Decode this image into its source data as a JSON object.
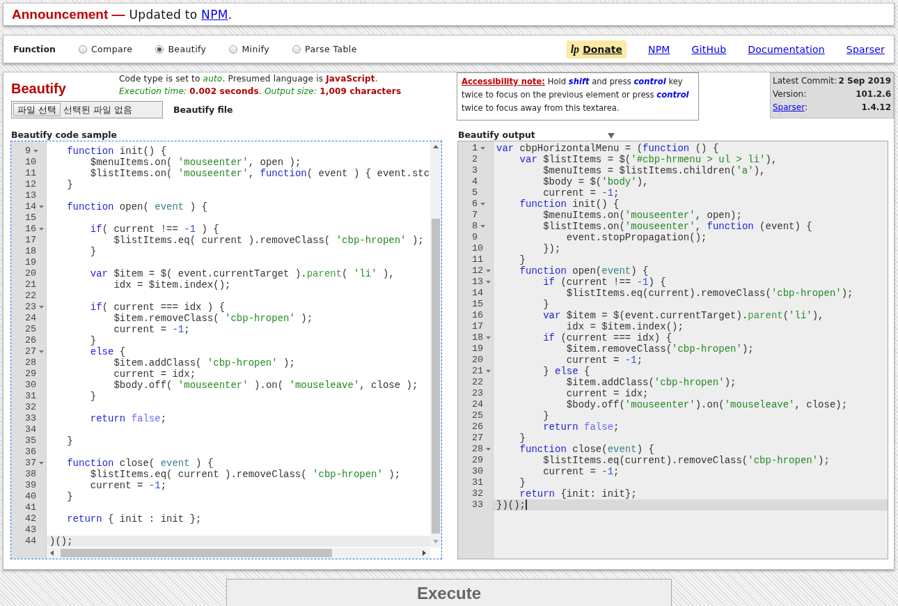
{
  "announcement": {
    "label": "Announcement —",
    "text": "Updated to ",
    "link": "NPM",
    "end": "."
  },
  "function_bar": {
    "label": "Function",
    "options": [
      {
        "label": "Compare",
        "selected": false
      },
      {
        "label": "Beautify",
        "selected": true
      },
      {
        "label": "Minify",
        "selected": false
      },
      {
        "label": "Parse Table",
        "selected": false
      }
    ],
    "donate": {
      "logo": "lp",
      "label": "Donate"
    },
    "links": [
      "NPM",
      "GitHub",
      "Documentation",
      "Sparser"
    ]
  },
  "panel": {
    "title": "Beautify",
    "status": [
      "Code type is set to *auto*. Presumed language is **JavaScript**.",
      "*Execution time:* **0.002 seconds**. *Output size:* **1,009 characters**"
    ],
    "file_input": {
      "button": "파일 선택",
      "status": "선택된 파일 없음"
    },
    "file_label": "Beautify file",
    "accessibility_note": "**Accessibility note:** Hold *shift* and press *control* key twice to focus on the previous element or press *control* twice to focus away from this textarea.",
    "version_info": [
      {
        "kind": "text",
        "label": "Latest Commit:",
        "value": "2 Sep 2019"
      },
      {
        "kind": "text",
        "label": "Version:",
        "value": "101.2.6"
      },
      {
        "kind": "link",
        "label": "Sparser",
        "suffix": ":",
        "value": "1.4.12"
      }
    ],
    "editors": [
      {
        "title": "Beautify code sample",
        "kind": "input",
        "focused": true,
        "scrollbars": true,
        "menu": false,
        "caret": false,
        "lines": [
          {
            "number": "9",
            "foldable": true,
            "active": false,
            "tokens": [
              {
                "text": "   function",
                "kind": "keyword"
              },
              {
                "text": " init() {",
                "kind": "plain"
              }
            ]
          },
          {
            "number": "10",
            "foldable": false,
            "active": false,
            "tokens": [
              {
                "text": "       $menuItems.on( ",
                "kind": "plain"
              },
              {
                "text": "'mouseenter'",
                "kind": "string"
              },
              {
                "text": ", open );",
                "kind": "plain"
              }
            ]
          },
          {
            "number": "11",
            "foldable": false,
            "active": false,
            "tokens": [
              {
                "text": "       $listItems.on( ",
                "kind": "plain"
              },
              {
                "text": "'mouseenter'",
                "kind": "string"
              },
              {
                "text": ", ",
                "kind": "plain"
              },
              {
                "text": "function",
                "kind": "keyword"
              },
              {
                "text": "( event ) { event.stc",
                "kind": "plain"
              }
            ]
          },
          {
            "number": "12",
            "foldable": false,
            "active": false,
            "tokens": [
              {
                "text": "   }",
                "kind": "plain"
              }
            ]
          },
          {
            "number": "13",
            "foldable": false,
            "active": false
          },
          {
            "number": "14",
            "foldable": true,
            "active": false,
            "tokens": [
              {
                "text": "   function",
                "kind": "keyword"
              },
              {
                "text": " open( ",
                "kind": "plain"
              },
              {
                "text": "event",
                "kind": "param"
              },
              {
                "text": " ) {",
                "kind": "plain"
              }
            ]
          },
          {
            "number": "15",
            "foldable": false,
            "active": false
          },
          {
            "number": "16",
            "foldable": true,
            "active": false,
            "tokens": [
              {
                "text": "       if",
                "kind": "keyword"
              },
              {
                "text": "( current !== ",
                "kind": "plain"
              },
              {
                "text": "-1",
                "kind": "number"
              },
              {
                "text": " ) {",
                "kind": "plain"
              }
            ]
          },
          {
            "number": "17",
            "foldable": false,
            "active": false,
            "tokens": [
              {
                "text": "           $listItems.eq( current ).removeClass( ",
                "kind": "plain"
              },
              {
                "text": "'cbp-hropen'",
                "kind": "string"
              },
              {
                "text": " );",
                "kind": "plain"
              }
            ]
          },
          {
            "number": "18",
            "foldable": false,
            "active": false,
            "tokens": [
              {
                "text": "       }",
                "kind": "plain"
              }
            ]
          },
          {
            "number": "19",
            "foldable": false,
            "active": false
          },
          {
            "number": "20",
            "foldable": false,
            "active": false,
            "tokens": [
              {
                "text": "       var",
                "kind": "keyword"
              },
              {
                "text": " $item = $( event.currentTarget ).",
                "kind": "plain"
              },
              {
                "text": "parent",
                "kind": "method"
              },
              {
                "text": "( ",
                "kind": "plain"
              },
              {
                "text": "'li'",
                "kind": "string"
              },
              {
                "text": " ),",
                "kind": "plain"
              }
            ]
          },
          {
            "number": "21",
            "foldable": false,
            "active": false,
            "tokens": [
              {
                "text": "           idx = $item.index();",
                "kind": "plain"
              }
            ]
          },
          {
            "number": "22",
            "foldable": false,
            "active": false
          },
          {
            "number": "23",
            "foldable": true,
            "active": false,
            "tokens": [
              {
                "text": "       if",
                "kind": "keyword"
              },
              {
                "text": "( current === idx ) {",
                "kind": "plain"
              }
            ]
          },
          {
            "number": "24",
            "foldable": false,
            "active": false,
            "tokens": [
              {
                "text": "           $item.removeClass( ",
                "kind": "plain"
              },
              {
                "text": "'cbp-hropen'",
                "kind": "string"
              },
              {
                "text": " );",
                "kind": "plain"
              }
            ]
          },
          {
            "number": "25",
            "foldable": false,
            "active": false,
            "tokens": [
              {
                "text": "           current = ",
                "kind": "plain"
              },
              {
                "text": "-1",
                "kind": "number"
              },
              {
                "text": ";",
                "kind": "plain"
              }
            ]
          },
          {
            "number": "26",
            "foldable": false,
            "active": false,
            "tokens": [
              {
                "text": "       }",
                "kind": "plain"
              }
            ]
          },
          {
            "number": "27",
            "foldable": true,
            "active": false,
            "tokens": [
              {
                "text": "       else",
                "kind": "keyword"
              },
              {
                "text": " {",
                "kind": "plain"
              }
            ]
          },
          {
            "number": "28",
            "foldable": false,
            "active": false,
            "tokens": [
              {
                "text": "           $item.addClass( ",
                "kind": "plain"
              },
              {
                "text": "'cbp-hropen'",
                "kind": "string"
              },
              {
                "text": " );",
                "kind": "plain"
              }
            ]
          },
          {
            "number": "29",
            "foldable": false,
            "active": false,
            "tokens": [
              {
                "text": "           current = idx;",
                "kind": "plain"
              }
            ]
          },
          {
            "number": "30",
            "foldable": false,
            "active": false,
            "tokens": [
              {
                "text": "           $body.off( ",
                "kind": "plain"
              },
              {
                "text": "'mouseenter'",
                "kind": "string"
              },
              {
                "text": " ).on( ",
                "kind": "plain"
              },
              {
                "text": "'mouseleave'",
                "kind": "string"
              },
              {
                "text": ", close );",
                "kind": "plain"
              }
            ]
          },
          {
            "number": "31",
            "foldable": false,
            "active": false,
            "tokens": [
              {
                "text": "       }",
                "kind": "plain"
              }
            ]
          },
          {
            "number": "32",
            "foldable": false,
            "active": false
          },
          {
            "number": "33",
            "foldable": false,
            "active": false,
            "tokens": [
              {
                "text": "       return",
                "kind": "keyword"
              },
              {
                "text": " false",
                "kind": "literal"
              },
              {
                "text": ";",
                "kind": "plain"
              }
            ]
          },
          {
            "number": "34",
            "foldable": false,
            "active": false
          },
          {
            "number": "35",
            "foldable": false,
            "active": false,
            "tokens": [
              {
                "text": "   }",
                "kind": "plain"
              }
            ]
          },
          {
            "number": "36",
            "foldable": false,
            "active": false
          },
          {
            "number": "37",
            "foldable": true,
            "active": false,
            "tokens": [
              {
                "text": "   function",
                "kind": "keyword"
              },
              {
                "text": " close( ",
                "kind": "plain"
              },
              {
                "text": "event",
                "kind": "param"
              },
              {
                "text": " ) {",
                "kind": "plain"
              }
            ]
          },
          {
            "number": "38",
            "foldable": false,
            "active": false,
            "tokens": [
              {
                "text": "       $listItems.eq( current ).removeClass( ",
                "kind": "plain"
              },
              {
                "text": "'cbp-hropen'",
                "kind": "string"
              },
              {
                "text": " );",
                "kind": "plain"
              }
            ]
          },
          {
            "number": "39",
            "foldable": false,
            "active": false,
            "tokens": [
              {
                "text": "       current = ",
                "kind": "plain"
              },
              {
                "text": "-1",
                "kind": "number"
              },
              {
                "text": ";",
                "kind": "plain"
              }
            ]
          },
          {
            "number": "40",
            "foldable": false,
            "active": false,
            "tokens": [
              {
                "text": "   }",
                "kind": "plain"
              }
            ]
          },
          {
            "number": "41",
            "foldable": false,
            "active": false
          },
          {
            "number": "42",
            "foldable": false,
            "active": false,
            "tokens": [
              {
                "text": "   return",
                "kind": "keyword"
              },
              {
                "text": " { init : init };",
                "kind": "plain"
              }
            ]
          },
          {
            "number": "43",
            "foldable": false,
            "active": false
          },
          {
            "number": "44",
            "foldable": false,
            "active": true,
            "tokens": [
              {
                "text": ")();",
                "kind": "plain"
              }
            ]
          }
        ]
      },
      {
        "title": "Beautify output",
        "kind": "output",
        "focused": false,
        "scrollbars": false,
        "menu": true,
        "caret": true,
        "lines": [
          {
            "number": "1",
            "foldable": true,
            "active": false,
            "tokens": [
              {
                "text": "var",
                "kind": "keyword"
              },
              {
                "text": " cbpHorizontalMenu = (",
                "kind": "plain"
              },
              {
                "text": "function",
                "kind": "keyword"
              },
              {
                "text": " () {",
                "kind": "plain"
              }
            ]
          },
          {
            "number": "2",
            "foldable": false,
            "active": false,
            "tokens": [
              {
                "text": "    var",
                "kind": "keyword"
              },
              {
                "text": " $listItems = $(",
                "kind": "plain"
              },
              {
                "text": "'#cbp-hrmenu > ul > li'",
                "kind": "string"
              },
              {
                "text": "),",
                "kind": "plain"
              }
            ]
          },
          {
            "number": "3",
            "foldable": false,
            "active": false,
            "tokens": [
              {
                "text": "        $menuItems = $listItems.children(",
                "kind": "plain"
              },
              {
                "text": "'a'",
                "kind": "string"
              },
              {
                "text": "),",
                "kind": "plain"
              }
            ]
          },
          {
            "number": "4",
            "foldable": false,
            "active": false,
            "tokens": [
              {
                "text": "        $body = $(",
                "kind": "plain"
              },
              {
                "text": "'body'",
                "kind": "string"
              },
              {
                "text": "),",
                "kind": "plain"
              }
            ]
          },
          {
            "number": "5",
            "foldable": false,
            "active": false,
            "tokens": [
              {
                "text": "        current = ",
                "kind": "plain"
              },
              {
                "text": "-1",
                "kind": "number"
              },
              {
                "text": ";",
                "kind": "plain"
              }
            ]
          },
          {
            "number": "6",
            "foldable": true,
            "active": false,
            "tokens": [
              {
                "text": "    function",
                "kind": "keyword"
              },
              {
                "text": " init() {",
                "kind": "plain"
              }
            ]
          },
          {
            "number": "7",
            "foldable": false,
            "active": false,
            "tokens": [
              {
                "text": "        $menuItems.on(",
                "kind": "plain"
              },
              {
                "text": "'mouseenter'",
                "kind": "string"
              },
              {
                "text": ", open);",
                "kind": "plain"
              }
            ]
          },
          {
            "number": "8",
            "foldable": true,
            "active": false,
            "tokens": [
              {
                "text": "        $listItems.on(",
                "kind": "plain"
              },
              {
                "text": "'mouseenter'",
                "kind": "string"
              },
              {
                "text": ", ",
                "kind": "plain"
              },
              {
                "text": "function",
                "kind": "keyword"
              },
              {
                "text": " (event) {",
                "kind": "plain"
              }
            ]
          },
          {
            "number": "9",
            "foldable": false,
            "active": false,
            "tokens": [
              {
                "text": "            event.stopPropagation();",
                "kind": "plain"
              }
            ]
          },
          {
            "number": "10",
            "foldable": false,
            "active": false,
            "tokens": [
              {
                "text": "        });",
                "kind": "plain"
              }
            ]
          },
          {
            "number": "11",
            "foldable": false,
            "active": false,
            "tokens": [
              {
                "text": "    }",
                "kind": "plain"
              }
            ]
          },
          {
            "number": "12",
            "foldable": true,
            "active": false,
            "tokens": [
              {
                "text": "    function",
                "kind": "keyword"
              },
              {
                "text": " open(",
                "kind": "plain"
              },
              {
                "text": "event",
                "kind": "param"
              },
              {
                "text": ") {",
                "kind": "plain"
              }
            ]
          },
          {
            "number": "13",
            "foldable": true,
            "active": false,
            "tokens": [
              {
                "text": "        if",
                "kind": "keyword"
              },
              {
                "text": " (current !== ",
                "kind": "plain"
              },
              {
                "text": "-1",
                "kind": "number"
              },
              {
                "text": ") {",
                "kind": "plain"
              }
            ]
          },
          {
            "number": "14",
            "foldable": false,
            "active": false,
            "tokens": [
              {
                "text": "            $listItems.eq(current).removeClass(",
                "kind": "plain"
              },
              {
                "text": "'cbp-hropen'",
                "kind": "string"
              },
              {
                "text": ");",
                "kind": "plain"
              }
            ]
          },
          {
            "number": "15",
            "foldable": false,
            "active": false,
            "tokens": [
              {
                "text": "        }",
                "kind": "plain"
              }
            ]
          },
          {
            "number": "16",
            "foldable": false,
            "active": false,
            "tokens": [
              {
                "text": "        var",
                "kind": "keyword"
              },
              {
                "text": " $item = $(event.currentTarget).",
                "kind": "plain"
              },
              {
                "text": "parent",
                "kind": "method"
              },
              {
                "text": "(",
                "kind": "plain"
              },
              {
                "text": "'li'",
                "kind": "string"
              },
              {
                "text": "),",
                "kind": "plain"
              }
            ]
          },
          {
            "number": "17",
            "foldable": false,
            "active": false,
            "tokens": [
              {
                "text": "            idx = $item.index();",
                "kind": "plain"
              }
            ]
          },
          {
            "number": "18",
            "foldable": true,
            "active": false,
            "tokens": [
              {
                "text": "        if",
                "kind": "keyword"
              },
              {
                "text": " (current === idx) {",
                "kind": "plain"
              }
            ]
          },
          {
            "number": "19",
            "foldable": false,
            "active": false,
            "tokens": [
              {
                "text": "            $item.removeClass(",
                "kind": "plain"
              },
              {
                "text": "'cbp-hropen'",
                "kind": "string"
              },
              {
                "text": ");",
                "kind": "plain"
              }
            ]
          },
          {
            "number": "20",
            "foldable": false,
            "active": false,
            "tokens": [
              {
                "text": "            current = ",
                "kind": "plain"
              },
              {
                "text": "-1",
                "kind": "number"
              },
              {
                "text": ";",
                "kind": "plain"
              }
            ]
          },
          {
            "number": "21",
            "foldable": true,
            "active": false,
            "tokens": [
              {
                "text": "        } ",
                "kind": "plain"
              },
              {
                "text": "else",
                "kind": "keyword"
              },
              {
                "text": " {",
                "kind": "plain"
              }
            ]
          },
          {
            "number": "22",
            "foldable": false,
            "active": false,
            "tokens": [
              {
                "text": "            $item.addClass(",
                "kind": "plain"
              },
              {
                "text": "'cbp-hropen'",
                "kind": "string"
              },
              {
                "text": ");",
                "kind": "plain"
              }
            ]
          },
          {
            "number": "23",
            "foldable": false,
            "active": false,
            "tokens": [
              {
                "text": "            current = idx;",
                "kind": "plain"
              }
            ]
          },
          {
            "number": "24",
            "foldable": false,
            "active": false,
            "tokens": [
              {
                "text": "            $body.off(",
                "kind": "plain"
              },
              {
                "text": "'mouseenter'",
                "kind": "string"
              },
              {
                "text": ").on(",
                "kind": "plain"
              },
              {
                "text": "'mouseleave'",
                "kind": "string"
              },
              {
                "text": ", close);",
                "kind": "plain"
              }
            ]
          },
          {
            "number": "25",
            "foldable": false,
            "active": false,
            "tokens": [
              {
                "text": "        }",
                "kind": "plain"
              }
            ]
          },
          {
            "number": "26",
            "foldable": false,
            "active": false,
            "tokens": [
              {
                "text": "        return",
                "kind": "keyword"
              },
              {
                "text": " false",
                "kind": "literal"
              },
              {
                "text": ";",
                "kind": "plain"
              }
            ]
          },
          {
            "number": "27",
            "foldable": false,
            "active": false,
            "tokens": [
              {
                "text": "    }",
                "kind": "plain"
              }
            ]
          },
          {
            "number": "28",
            "foldable": true,
            "active": false,
            "tokens": [
              {
                "text": "    function",
                "kind": "keyword"
              },
              {
                "text": " close(",
                "kind": "plain"
              },
              {
                "text": "event",
                "kind": "param"
              },
              {
                "text": ") {",
                "kind": "plain"
              }
            ]
          },
          {
            "number": "29",
            "foldable": false,
            "active": false,
            "tokens": [
              {
                "text": "        $listItems.eq(current).removeClass(",
                "kind": "plain"
              },
              {
                "text": "'cbp-hropen'",
                "kind": "string"
              },
              {
                "text": ");",
                "kind": "plain"
              }
            ]
          },
          {
            "number": "30",
            "foldable": false,
            "active": false,
            "tokens": [
              {
                "text": "        current = ",
                "kind": "plain"
              },
              {
                "text": "-1",
                "kind": "number"
              },
              {
                "text": ";",
                "kind": "plain"
              }
            ]
          },
          {
            "number": "31",
            "foldable": false,
            "active": false,
            "tokens": [
              {
                "text": "    }",
                "kind": "plain"
              }
            ]
          },
          {
            "number": "32",
            "foldable": false,
            "active": false,
            "tokens": [
              {
                "text": "    return",
                "kind": "keyword"
              },
              {
                "text": " {init: init};",
                "kind": "plain"
              }
            ]
          },
          {
            "number": "33",
            "foldable": false,
            "active": true,
            "tokens": [
              {
                "text": "})();",
                "kind": "plain"
              }
            ]
          }
        ]
      }
    ]
  },
  "execute_button": "Execute"
}
